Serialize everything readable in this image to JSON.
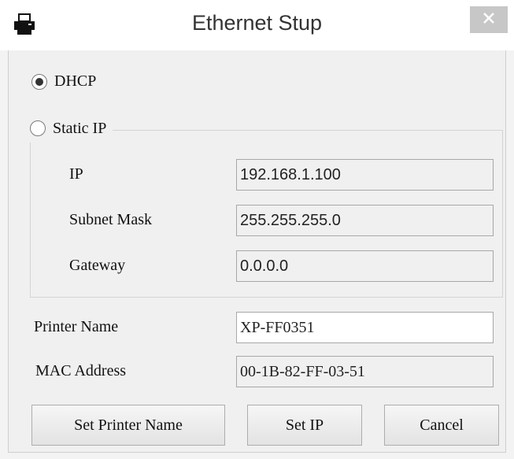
{
  "window": {
    "title": "Ethernet Stup",
    "icon": "printer-icon",
    "close_glyph": "✕"
  },
  "network_mode": {
    "dhcp_label": "DHCP",
    "static_label": "Static IP",
    "selected": "DHCP"
  },
  "static_ip": {
    "ip_label": "IP",
    "ip_value": "192.168.1.100",
    "subnet_label": "Subnet Mask",
    "subnet_value": "255.255.255.0",
    "gateway_label": "Gateway",
    "gateway_value": "0.0.0.0"
  },
  "printer": {
    "name_label": "Printer Name",
    "name_value": "XP-FF0351",
    "mac_label": "MAC Address",
    "mac_value": "00-1B-82-FF-03-51"
  },
  "buttons": {
    "set_printer_name": "Set Printer Name",
    "set_ip": "Set IP",
    "cancel": "Cancel"
  }
}
